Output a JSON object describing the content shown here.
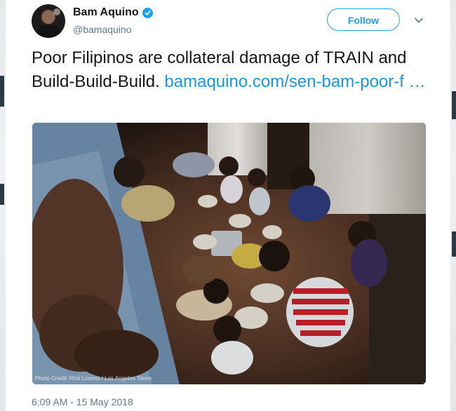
{
  "tweet": {
    "display_name": "Bam Aquino",
    "handle": "@bamaquino",
    "follow_label": "Follow",
    "text": "Poor Filipinos are collateral damage of TRAIN and Build-Build-Build. ",
    "link_text": "bamaquino.com/sen-bam-poor-f  …",
    "photo_credit": "Photo Credit: Rick Loomis / Los Angeles Times",
    "timestamp": "6:09 AM - 15 May 2018"
  },
  "icons": {
    "verified": "verified-badge-icon",
    "caret": "chevron-down-icon"
  },
  "colors": {
    "accent": "#1da1f2",
    "link": "#1b95e0",
    "text": "#14171a",
    "muted": "#657786"
  }
}
